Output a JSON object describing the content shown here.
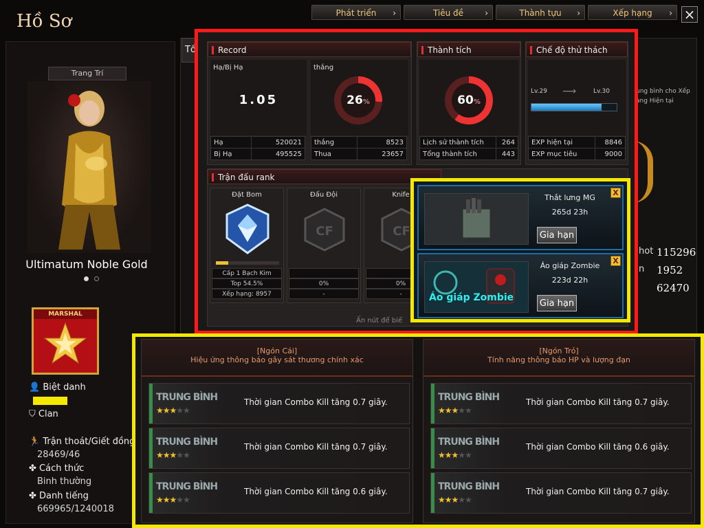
{
  "nav": {
    "tabs": [
      "Phát triển",
      "Tiêu đề",
      "Thành tựu",
      "Xếp hạng"
    ]
  },
  "page_title": "Hồ Sơ",
  "profile": {
    "deco_label": "Trang Trí",
    "char_name": "Ultimatum Noble Gold",
    "rank_badge_label": "MARSHAL",
    "nickname_label": "Biệt danh",
    "clan_label": "Clan",
    "escape_label": "Trận thoát/Giết đồng độ",
    "escape_value": "28469/46",
    "style_label": "Cách thức",
    "style_value": "Binh thường",
    "fame_label": "Danh tiếng",
    "fame_value": "669965/1240018",
    "tab_partial": "Tổ"
  },
  "right_stats": {
    "values": [
      "115296",
      "1952",
      "62470"
    ],
    "partial_labels": [
      "hot",
      "n"
    ],
    "side_text": [
      "ung bình cho Xếp",
      "ang Hiện tại"
    ]
  },
  "record": {
    "title": "Record",
    "kd_label": "Hạ/Bị Hạ",
    "kd_value": "1.05",
    "win_label": "thắng",
    "win_pct": "26",
    "pct_sign": "%",
    "kills_label": "Hạ",
    "kills_value": "520021",
    "deaths_label": "Bị Hạ",
    "deaths_value": "495525",
    "wins_label": "thắng",
    "wins_value": "8523",
    "losses_label": "Thua",
    "losses_value": "23657"
  },
  "achievements": {
    "title": "Thành tích",
    "pct": "60",
    "pct_sign": "%",
    "history_label": "Lịch sử thành tích",
    "history_value": "264",
    "total_label": "Tổng thành tích",
    "total_value": "443"
  },
  "challenge": {
    "title": "Chế độ thử thách",
    "lv_from": "Lv.29",
    "lv_to": "Lv.30",
    "exp_progress": 0.82,
    "exp_now_label": "EXP hiện tại",
    "exp_now_value": "8846",
    "exp_target_label": "EXP mục tiêu",
    "exp_target_value": "9000"
  },
  "rank_matches": {
    "title": "Trận đấu rank",
    "columns": [
      {
        "mode": "Đặt Bom",
        "rank": "Cấp 1 Bạch Kim",
        "top": "Top 54.5%",
        "position": "Xếp hạng: 8957"
      },
      {
        "mode": "Đấu Đội",
        "rank": "",
        "top": "0%",
        "position": "-"
      },
      {
        "mode": "Knife",
        "rank": "",
        "top": "0%",
        "position": "-"
      }
    ],
    "footer_hint": "Ấn nút để biế"
  },
  "items": [
    {
      "name": "Thắt lưng MG",
      "time": "265d 23h",
      "renew": "Gia hạn",
      "close": "X"
    },
    {
      "name": "Áo giáp Zombie",
      "time": "223d 22h",
      "renew": "Gia hạn",
      "close": "X",
      "image_text": "Áo giáp Zombie"
    }
  ],
  "slots": [
    {
      "header_a": "[Ngón Cái]",
      "header_b": "Hiệu ứng thông báo gây sát thương chính xác",
      "effects": [
        {
          "level": "TRUNG BÌNH",
          "stars": 3,
          "desc": "Thời gian Combo Kill tăng 0.7 giây."
        },
        {
          "level": "TRUNG BÌNH",
          "stars": 3,
          "desc": "Thời gian Combo Kill tăng 0.7 giây."
        },
        {
          "level": "TRUNG BÌNH",
          "stars": 3,
          "desc": "Thời gian Combo Kill tăng 0.6 giây."
        }
      ]
    },
    {
      "header_a": "[Ngón Trỏ]",
      "header_b": "Tính năng thông báo HP và lượng đạn",
      "effects": [
        {
          "level": "TRUNG BÌNH",
          "stars": 3,
          "desc": "Thời gian Combo Kill tăng 0.7 giây."
        },
        {
          "level": "TRUNG BÌNH",
          "stars": 3,
          "desc": "Thời gian Combo Kill tăng 0.6 giây."
        },
        {
          "level": "TRUNG BÌNH",
          "stars": 3,
          "desc": "Thời gian Combo Kill tăng 0.7 giây."
        }
      ]
    }
  ],
  "colors": {
    "highlight_red": "#ff1a1a",
    "highlight_yellow": "#f5e800",
    "accent_gold": "#f0c77a"
  }
}
